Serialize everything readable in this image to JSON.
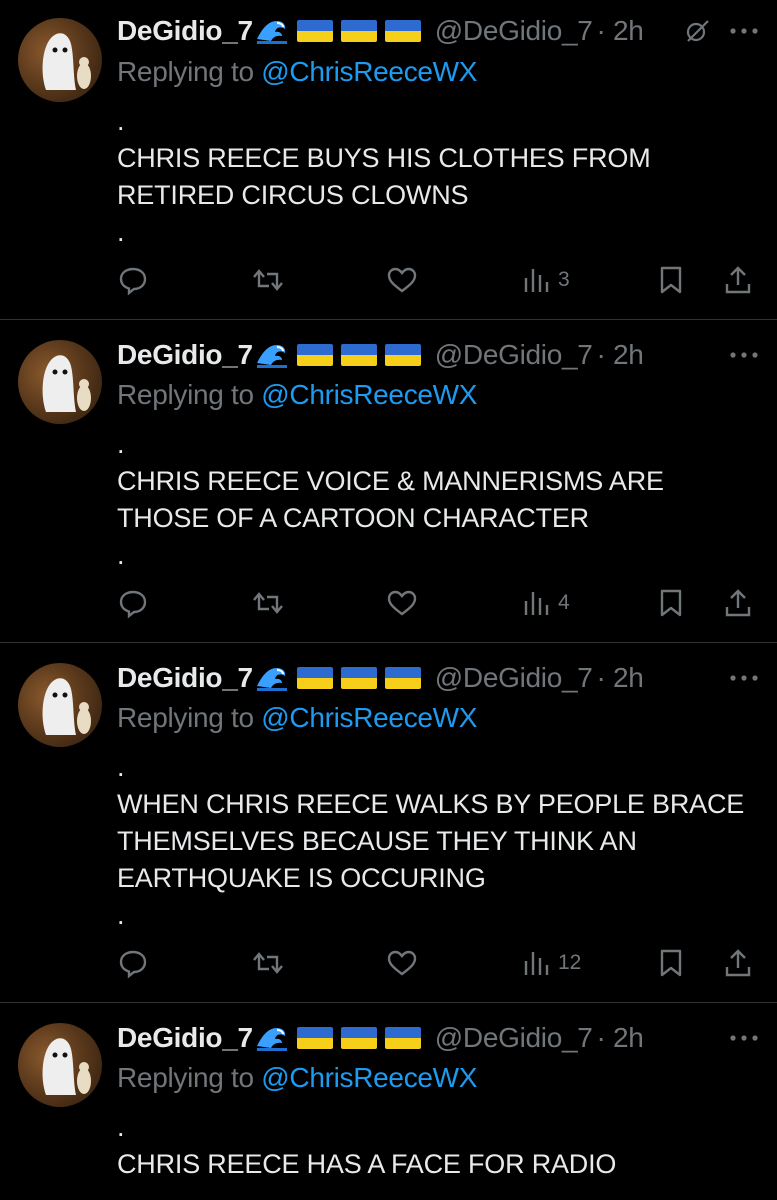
{
  "tweets": [
    {
      "display_name": "DeGidio_7",
      "handle": "@DeGidio_7",
      "time": "· 2h",
      "replying_prefix": "Replying to",
      "replying_to": "@ChrisReeceWX",
      "lines_before": ".",
      "text": "CHRIS REECE BUYS HIS CLOTHES FROM RETIRED CIRCUS CLOWNS",
      "lines_after": ".",
      "views": "3"
    },
    {
      "display_name": "DeGidio_7",
      "handle": "@DeGidio_7",
      "time": "· 2h",
      "replying_prefix": "Replying to",
      "replying_to": "@ChrisReeceWX",
      "lines_before": ".",
      "text": "CHRIS REECE VOICE & MANNERISMS ARE THOSE OF A CARTOON CHARACTER",
      "lines_after": ".",
      "views": "4"
    },
    {
      "display_name": "DeGidio_7",
      "handle": "@DeGidio_7",
      "time": "· 2h",
      "replying_prefix": "Replying to",
      "replying_to": "@ChrisReeceWX",
      "lines_before": ".",
      "text": "WHEN CHRIS REECE WALKS BY PEOPLE BRACE THEMSELVES BECAUSE THEY THINK AN EARTHQUAKE IS OCCURING",
      "lines_after": ".",
      "views": "12"
    },
    {
      "display_name": "DeGidio_7",
      "handle": "@DeGidio_7",
      "time": "· 2h",
      "replying_prefix": "Replying to",
      "replying_to": "@ChrisReeceWX",
      "lines_before": ".",
      "text": "CHRIS REECE HAS A FACE FOR RADIO",
      "lines_after": "",
      "views": ""
    }
  ],
  "icons": {
    "name_emoji": [
      "wave-icon",
      "ukraine-flag",
      "ukraine-flag",
      "ukraine-flag"
    ],
    "header_right": [
      "grok-icon",
      "more-icon"
    ],
    "actions": [
      "reply-icon",
      "retweet-icon",
      "like-icon",
      "views-icon",
      "bookmark-icon",
      "share-icon"
    ]
  },
  "colors": {
    "background": "#000000",
    "text": "#e7e9ea",
    "secondary": "#71767b",
    "link": "#1d9bf0",
    "divider": "#2f3336",
    "flag_blue": "#2e6bd0",
    "flag_yellow": "#f6cf1a"
  }
}
